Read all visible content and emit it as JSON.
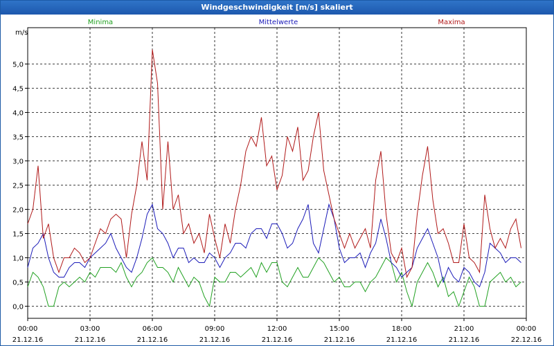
{
  "window": {
    "title": "Windgeschwindigkeit [m/s] skaliert"
  },
  "chart_data": {
    "type": "line",
    "title": "Windgeschwindigkeit [m/s] skaliert",
    "ylabel": "m/s",
    "xlabel": "",
    "ylim": [
      -0.25,
      5.75
    ],
    "xlim": [
      0,
      24
    ],
    "yticks": [
      "0,0",
      "0,5",
      "1,0",
      "1,5",
      "2,0",
      "2,5",
      "3,0",
      "3,5",
      "4,0",
      "4,5",
      "5,0"
    ],
    "yticks_values": [
      0,
      0.5,
      1.0,
      1.5,
      2.0,
      2.5,
      3.0,
      3.5,
      4.0,
      4.5,
      5.0
    ],
    "xticks_values": [
      0,
      3,
      6,
      9,
      12,
      15,
      18,
      21,
      24
    ],
    "xticks_time": [
      "00:00",
      "03:00",
      "06:00",
      "09:00",
      "12:00",
      "15:00",
      "18:00",
      "21:00",
      "00:00"
    ],
    "xticks_date": [
      "21.12.16",
      "21.12.16",
      "21.12.16",
      "21.12.16",
      "21.12.16",
      "21.12.16",
      "21.12.16",
      "21.12.16",
      "22.12.16"
    ],
    "grid": true,
    "legend": [
      "Minima",
      "Mittelwerte",
      "Maxima"
    ],
    "series": [
      {
        "name": "Minima",
        "color": "#20a020",
        "x": [
          0,
          0.25,
          0.5,
          0.75,
          1,
          1.25,
          1.5,
          1.75,
          2,
          2.25,
          2.5,
          2.75,
          3,
          3.25,
          3.5,
          3.75,
          4,
          4.25,
          4.5,
          4.75,
          5,
          5.25,
          5.5,
          5.75,
          6,
          6.25,
          6.5,
          6.75,
          7,
          7.25,
          7.5,
          7.75,
          8,
          8.25,
          8.5,
          8.75,
          9,
          9.25,
          9.5,
          9.75,
          10,
          10.25,
          10.5,
          10.75,
          11,
          11.25,
          11.5,
          11.75,
          12,
          12.25,
          12.5,
          12.75,
          13,
          13.25,
          13.5,
          13.75,
          14,
          14.25,
          14.5,
          14.75,
          15,
          15.25,
          15.5,
          15.75,
          16,
          16.25,
          16.5,
          16.75,
          17,
          17.25,
          17.5,
          17.75,
          18,
          18.25,
          18.5,
          18.75,
          19,
          19.25,
          19.5,
          19.75,
          20,
          20.25,
          20.5,
          20.75,
          21,
          21.25,
          21.5,
          21.75,
          22,
          22.25,
          22.5,
          22.75,
          23,
          23.25,
          23.5,
          23.75
        ],
        "values": [
          0.4,
          0.7,
          0.6,
          0.4,
          0.0,
          0.0,
          0.4,
          0.5,
          0.4,
          0.5,
          0.6,
          0.5,
          0.7,
          0.6,
          0.8,
          0.8,
          0.8,
          0.7,
          0.9,
          0.6,
          0.4,
          0.6,
          0.7,
          0.9,
          1.0,
          0.8,
          0.8,
          0.7,
          0.5,
          0.8,
          0.6,
          0.4,
          0.6,
          0.5,
          0.2,
          0.0,
          0.6,
          0.5,
          0.5,
          0.7,
          0.7,
          0.6,
          0.7,
          0.8,
          0.6,
          0.9,
          0.7,
          0.9,
          0.9,
          0.5,
          0.4,
          0.6,
          0.8,
          0.6,
          0.6,
          0.8,
          1.0,
          0.9,
          0.7,
          0.5,
          0.6,
          0.4,
          0.4,
          0.5,
          0.5,
          0.3,
          0.5,
          0.6,
          0.8,
          1.0,
          0.9,
          0.5,
          0.7,
          0.3,
          0.0,
          0.5,
          0.7,
          0.9,
          0.7,
          0.4,
          0.6,
          0.2,
          0.3,
          0.0,
          0.3,
          0.6,
          0.4,
          0.0,
          0.0,
          0.5,
          0.6,
          0.7,
          0.5,
          0.6,
          0.4,
          0.5
        ]
      },
      {
        "name": "Mittelwerte",
        "color": "#1a1ab8",
        "x": [
          0,
          0.25,
          0.5,
          0.75,
          1,
          1.25,
          1.5,
          1.75,
          2,
          2.25,
          2.5,
          2.75,
          3,
          3.25,
          3.5,
          3.75,
          4,
          4.25,
          4.5,
          4.75,
          5,
          5.25,
          5.5,
          5.75,
          6,
          6.25,
          6.5,
          6.75,
          7,
          7.25,
          7.5,
          7.75,
          8,
          8.25,
          8.5,
          8.75,
          9,
          9.25,
          9.5,
          9.75,
          10,
          10.25,
          10.5,
          10.75,
          11,
          11.25,
          11.5,
          11.75,
          12,
          12.25,
          12.5,
          12.75,
          13,
          13.25,
          13.5,
          13.75,
          14,
          14.25,
          14.5,
          14.75,
          15,
          15.25,
          15.5,
          15.75,
          16,
          16.25,
          16.5,
          16.75,
          17,
          17.25,
          17.5,
          17.75,
          18,
          18.25,
          18.5,
          18.75,
          19,
          19.25,
          19.5,
          19.75,
          20,
          20.25,
          20.5,
          20.75,
          21,
          21.25,
          21.5,
          21.75,
          22,
          22.25,
          22.5,
          22.75,
          23,
          23.25,
          23.5,
          23.75
        ],
        "values": [
          0.8,
          1.2,
          1.3,
          1.5,
          1.0,
          0.7,
          0.6,
          0.6,
          0.8,
          0.9,
          0.9,
          0.8,
          1.0,
          1.1,
          1.2,
          1.3,
          1.5,
          1.2,
          1.0,
          0.8,
          0.7,
          1.0,
          1.4,
          1.9,
          2.1,
          1.6,
          1.5,
          1.3,
          1.0,
          1.2,
          1.2,
          0.9,
          1.0,
          0.9,
          0.9,
          1.1,
          1.0,
          0.8,
          1.0,
          1.1,
          1.3,
          1.3,
          1.2,
          1.5,
          1.6,
          1.6,
          1.4,
          1.7,
          1.7,
          1.5,
          1.2,
          1.3,
          1.6,
          1.8,
          2.1,
          1.3,
          1.1,
          1.6,
          2.1,
          1.8,
          1.2,
          0.9,
          1.0,
          1.0,
          1.1,
          0.8,
          1.1,
          1.3,
          1.8,
          1.4,
          0.9,
          0.8,
          0.6,
          0.7,
          0.8,
          1.2,
          1.4,
          1.6,
          1.3,
          1.0,
          0.5,
          0.8,
          0.6,
          0.5,
          0.8,
          0.7,
          0.5,
          0.4,
          0.7,
          1.3,
          1.2,
          1.1,
          0.9,
          1.0,
          1.0,
          0.9
        ]
      },
      {
        "name": "Maxima",
        "color": "#b01818",
        "x": [
          0,
          0.25,
          0.5,
          0.75,
          1,
          1.25,
          1.5,
          1.75,
          2,
          2.25,
          2.5,
          2.75,
          3,
          3.25,
          3.5,
          3.75,
          4,
          4.25,
          4.5,
          4.75,
          5,
          5.25,
          5.5,
          5.75,
          6,
          6.25,
          6.5,
          6.75,
          7,
          7.25,
          7.5,
          7.75,
          8,
          8.25,
          8.5,
          8.75,
          9,
          9.25,
          9.5,
          9.75,
          10,
          10.25,
          10.5,
          10.75,
          11,
          11.25,
          11.5,
          11.75,
          12,
          12.25,
          12.5,
          12.75,
          13,
          13.25,
          13.5,
          13.75,
          14,
          14.25,
          14.5,
          14.75,
          15,
          15.25,
          15.5,
          15.75,
          16,
          16.25,
          16.5,
          16.75,
          17,
          17.25,
          17.5,
          17.75,
          18,
          18.25,
          18.5,
          18.75,
          19,
          19.25,
          19.5,
          19.75,
          20,
          20.25,
          20.5,
          20.75,
          21,
          21.25,
          21.5,
          21.75,
          22,
          22.25,
          22.5,
          22.75,
          23,
          23.25,
          23.5,
          23.75
        ],
        "values": [
          1.7,
          2.0,
          2.9,
          1.4,
          1.7,
          1.0,
          0.7,
          1.0,
          1.0,
          1.2,
          1.1,
          0.9,
          1.0,
          1.3,
          1.6,
          1.5,
          1.8,
          1.9,
          1.8,
          1.0,
          1.9,
          2.5,
          3.4,
          2.6,
          5.3,
          4.6,
          2.0,
          3.4,
          2.0,
          2.3,
          1.5,
          1.7,
          1.3,
          1.5,
          1.1,
          1.9,
          1.4,
          1.0,
          1.7,
          1.3,
          2.0,
          2.5,
          3.2,
          3.5,
          3.3,
          3.9,
          2.9,
          3.1,
          2.4,
          2.7,
          3.5,
          3.2,
          3.7,
          2.6,
          2.8,
          3.5,
          4.0,
          2.8,
          2.3,
          1.8,
          1.5,
          1.2,
          1.5,
          1.2,
          1.4,
          1.6,
          1.2,
          2.6,
          3.2,
          1.9,
          1.1,
          0.9,
          1.2,
          0.6,
          0.8,
          1.9,
          2.7,
          3.3,
          2.2,
          1.5,
          1.6,
          1.3,
          0.9,
          0.9,
          1.7,
          1.0,
          0.9,
          0.7,
          2.3,
          1.6,
          1.2,
          1.4,
          1.2,
          1.6,
          1.8,
          1.2
        ]
      }
    ]
  }
}
